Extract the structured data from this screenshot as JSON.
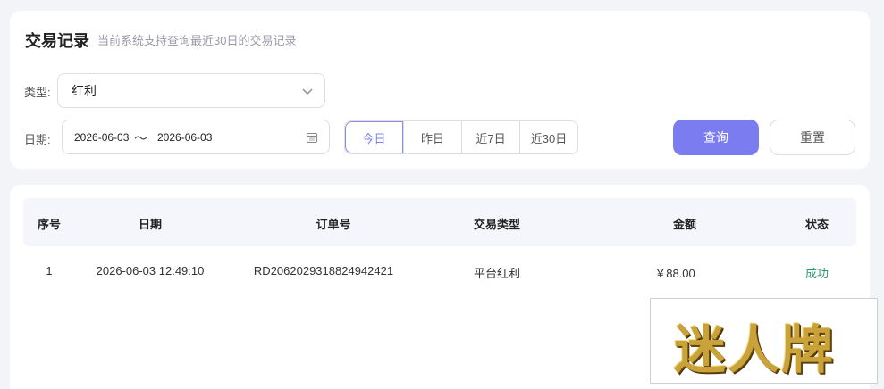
{
  "header": {
    "title": "交易记录",
    "subtitle": "当前系统支持查询最近30日的交易记录"
  },
  "filters": {
    "type_label": "类型:",
    "type_value": "红利",
    "date_label": "日期:",
    "date_start": "2026-06-03",
    "date_separator": "～",
    "date_end": "2026-06-03",
    "quick_ranges": [
      "今日",
      "昨日",
      "近7日",
      "近30日"
    ],
    "active_quick_range": "今日",
    "query_button": "查询",
    "reset_button": "重置"
  },
  "table": {
    "columns": [
      "序号",
      "日期",
      "订单号",
      "交易类型",
      "金额",
      "状态"
    ],
    "rows": [
      {
        "index": "1",
        "date": "2026-06-03 12:49:10",
        "order_no": "RD2062029318824942421",
        "type": "平台红利",
        "amount": "￥88.00",
        "status": "成功"
      }
    ]
  },
  "watermark": {
    "text": "迷人牌"
  },
  "colors": {
    "accent": "#7b7cf0",
    "success": "#2e9a6b",
    "background": "#f3f4f8"
  },
  "icons": {
    "select_arrow": "chevron-down-icon",
    "date_picker": "calendar-icon"
  }
}
